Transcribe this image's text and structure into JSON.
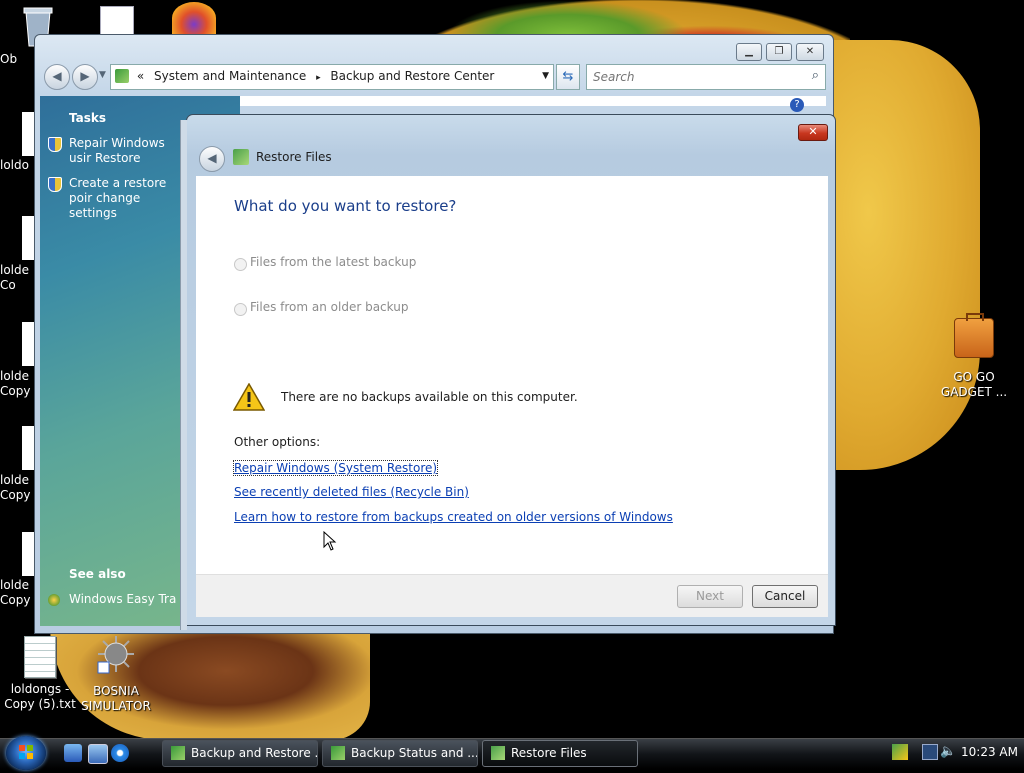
{
  "desktop": {
    "icons_left_partial": [
      {
        "text": "Ob"
      },
      {
        "text": "loldo"
      },
      {
        "text": "lolde Co"
      },
      {
        "text": "lolde Copy"
      },
      {
        "text": "lolde Copy"
      },
      {
        "text": "lolde Copy"
      }
    ],
    "loldongs_label": "loldongs - Copy (5).txt",
    "bosnia_label": "BOSNIA SIMULATOR",
    "gogo_label": "GO GO GADGET ..."
  },
  "explorer": {
    "address": {
      "prefix": "«",
      "part1": "System and Maintenance",
      "separator": "▸",
      "part2": "Backup and Restore Center"
    },
    "search_placeholder": "Search",
    "tasks_title": "Tasks",
    "task1": "Repair Windows usir Restore",
    "task2": "Create a restore poir change settings",
    "see_also_title": "See also",
    "see_also_item": "Windows Easy Trans"
  },
  "dialog": {
    "title": "Restore Files",
    "heading": "What do you want to restore?",
    "option1": "Files from the latest backup",
    "option2": "Files from an older backup",
    "warning": "There are no backups available on this computer.",
    "other_options": "Other options:",
    "link1": "Repair Windows (System Restore)",
    "link2": "See recently deleted files (Recycle Bin)",
    "link3": "Learn how to restore from backups created on older versions of Windows",
    "next_label": "Next",
    "cancel_label": "Cancel"
  },
  "taskbar": {
    "buttons": [
      {
        "label": "Backup and Restore ..."
      },
      {
        "label": "Backup Status and ..."
      },
      {
        "label": "Restore Files"
      }
    ],
    "clock": "10:23 AM"
  }
}
